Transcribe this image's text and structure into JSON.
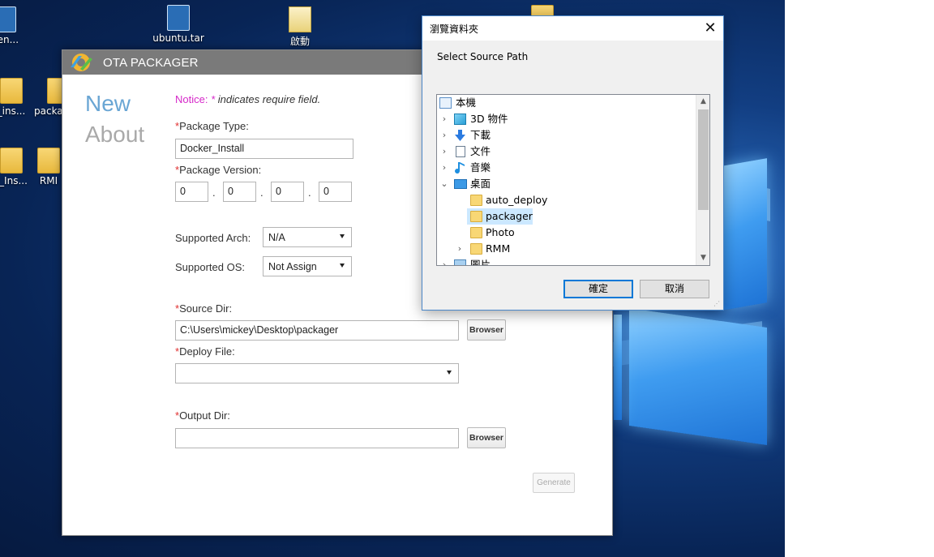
{
  "desktop": {
    "icons": [
      {
        "label": "gen..."
      },
      {
        "label": "ubuntu.tar"
      },
      {
        "label": "啟動"
      },
      {
        "label": "_ins..."
      },
      {
        "label": "packa"
      },
      {
        "label": "r_Ins..."
      },
      {
        "label": "RMI"
      }
    ]
  },
  "ota": {
    "title": "OTA PACKAGER",
    "nav": {
      "new": "New",
      "about": "About"
    },
    "notice_label": "Notice:",
    "notice_star": "*",
    "notice_text": "indicates require field.",
    "required_mark": "*",
    "package_type": {
      "label": "Package Type:",
      "value": "Docker_Install"
    },
    "package_version": {
      "label": "Package Version:",
      "parts": [
        "0",
        "0",
        "0",
        "0"
      ],
      "separator": "."
    },
    "supported_arch": {
      "label": "Supported Arch:",
      "value": "N/A"
    },
    "supported_os": {
      "label": "Supported OS:",
      "value": "Not Assign"
    },
    "source_dir": {
      "label": "Source Dir:",
      "value": "C:\\Users\\mickey\\Desktop\\packager",
      "browse": "Browser"
    },
    "deploy_file": {
      "label": "Deploy File:",
      "value": ""
    },
    "output_dir": {
      "label": "Output Dir:",
      "value": "",
      "browse": "Browser"
    },
    "generate": "Generate"
  },
  "dialog": {
    "title": "瀏覽資料夾",
    "close": "✕",
    "prompt": "Select Source Path",
    "tree": [
      {
        "label": "本機",
        "icon": "computer-icon"
      },
      {
        "label": "3D 物件",
        "icon": "3d-objects-icon"
      },
      {
        "label": "下載",
        "icon": "download-icon"
      },
      {
        "label": "文件",
        "icon": "document-icon"
      },
      {
        "label": "音樂",
        "icon": "music-icon"
      },
      {
        "label": "桌面",
        "icon": "desktop-icon"
      },
      {
        "label": "auto_deploy",
        "icon": "folder-icon"
      },
      {
        "label": "packager",
        "icon": "folder-icon"
      },
      {
        "label": "Photo",
        "icon": "folder-icon"
      },
      {
        "label": "RMM",
        "icon": "folder-icon"
      },
      {
        "label": "圖片",
        "icon": "pictures-icon"
      }
    ],
    "ok": "確定",
    "cancel": "取消"
  }
}
